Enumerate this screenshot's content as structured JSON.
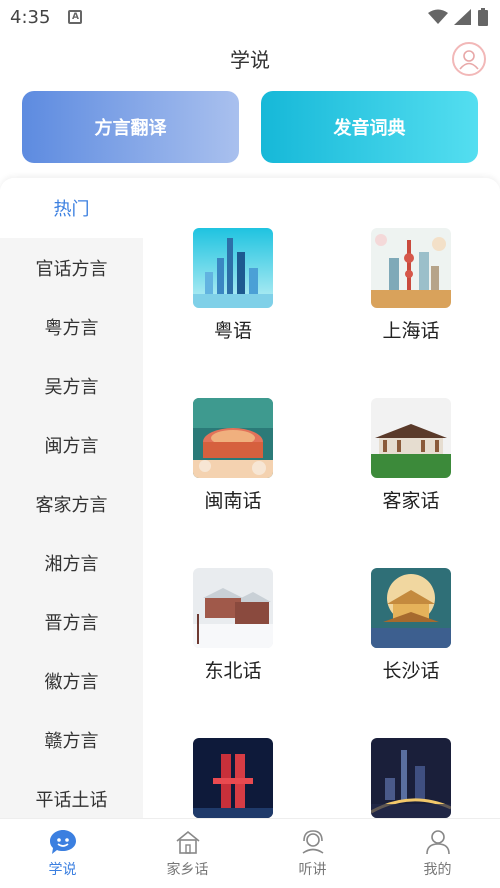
{
  "status_bar": {
    "time": "4:35",
    "notification_icon": "A"
  },
  "header": {
    "title": "学说"
  },
  "features": {
    "translate_label": "方言翻译",
    "dictionary_label": "发音词典"
  },
  "sidebar": {
    "hot_label": "热门",
    "items": [
      {
        "label": "官话方言"
      },
      {
        "label": "粤方言"
      },
      {
        "label": "吴方言"
      },
      {
        "label": "闽方言"
      },
      {
        "label": "客家方言"
      },
      {
        "label": "湘方言"
      },
      {
        "label": "晋方言"
      },
      {
        "label": "徽方言"
      },
      {
        "label": "赣方言"
      },
      {
        "label": "平话土话"
      }
    ]
  },
  "dialects": [
    {
      "name": "粤语",
      "image": "guangzhou-skyline-image"
    },
    {
      "name": "上海话",
      "image": "shanghai-skyline-image"
    },
    {
      "name": "闽南话",
      "image": "tulou-image"
    },
    {
      "name": "客家话",
      "image": "hakka-hall-image"
    },
    {
      "name": "东北话",
      "image": "snow-town-image"
    },
    {
      "name": "长沙话",
      "image": "changsha-pavilion-image"
    },
    {
      "name": "",
      "image": "night-tower-image"
    },
    {
      "name": "",
      "image": "night-city-image"
    }
  ],
  "bottom_nav": {
    "items": [
      {
        "label": "学说",
        "icon": "chat-face-icon",
        "active": true
      },
      {
        "label": "家乡话",
        "icon": "home-icon",
        "active": false
      },
      {
        "label": "听讲",
        "icon": "headset-icon",
        "active": false
      },
      {
        "label": "我的",
        "icon": "person-icon",
        "active": false
      }
    ]
  },
  "colors": {
    "accent": "#3b7fe0",
    "translate_start": "#5d8be0",
    "dict_start": "#16b8d8"
  }
}
